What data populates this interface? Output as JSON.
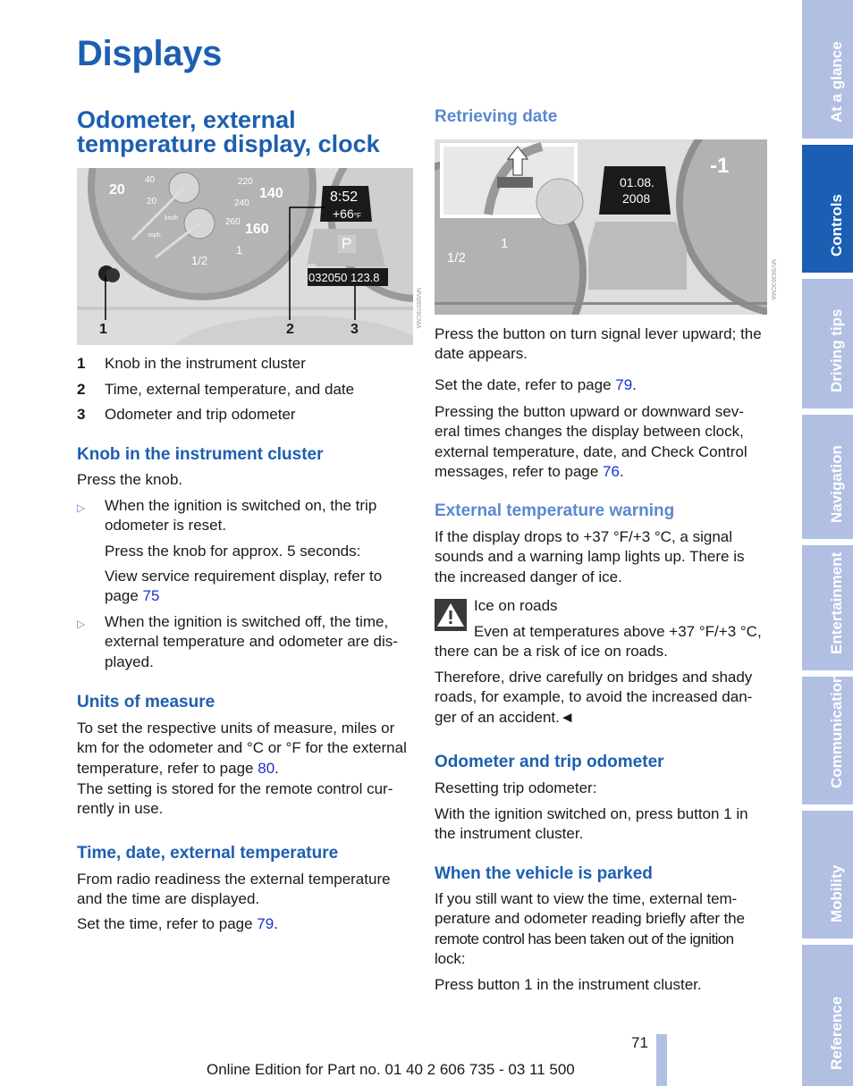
{
  "page_title": "Displays",
  "section_title": "Odometer, external temperature display, clock",
  "figure1": {
    "code": "MV06078CMA",
    "clock": "8:52",
    "temperature": "+66",
    "temp_unit": "°F",
    "gear": "P",
    "odo_unit": "mls",
    "odometer": "032050 123.8",
    "callouts": [
      "1",
      "2",
      "3"
    ],
    "gauge_labels": [
      "20",
      "40",
      "20",
      "km/h",
      "mph",
      "220",
      "240",
      "260",
      "140",
      "160",
      "1/2",
      "1"
    ]
  },
  "legend": [
    {
      "num": "1",
      "text": "Knob in the instrument cluster"
    },
    {
      "num": "2",
      "text": "Time, external temperature, and date"
    },
    {
      "num": "3",
      "text": "Odometer and trip odometer"
    }
  ],
  "knob": {
    "heading": "Knob in the instrument cluster",
    "intro": "Press the knob.",
    "bullet1": [
      "When the ignition is switched on, the trip",
      "odometer is reset."
    ],
    "sub1": "Press the knob for approx. 5 seconds:",
    "sub2_pre": [
      "View service requirement display, refer to",
      "page "
    ],
    "sub2_link": "75",
    "bullet2": [
      "When the ignition is switched off, the time,",
      "external temperature and odometer are dis-",
      "played."
    ]
  },
  "units": {
    "heading": "Units of measure",
    "para1": [
      "To set the respective units of measure, miles or",
      "km for the odometer and °C or °F for the external",
      "temperature, refer to page "
    ],
    "para1_link": "80",
    "para2": [
      "The setting is stored for the remote control cur-",
      "rently in use."
    ]
  },
  "timedate": {
    "heading": "Time, date, external temperature",
    "para1": [
      "From radio readiness the external temperature",
      "and the time are displayed."
    ],
    "para2_pre": "Set the time, refer to page ",
    "para2_link": "79"
  },
  "retrieving": {
    "heading": "Retrieving date",
    "figure_code": "MV06363CMA",
    "date_line1": "01.08.",
    "date_line2": "2008",
    "gauge_labels": [
      "-1",
      "1/2",
      "1"
    ],
    "para1": [
      "Press the button on turn signal lever upward; the",
      "date appears."
    ],
    "para2_pre": "Set the date, refer to page ",
    "para2_link": "79",
    "para3": [
      "Pressing the button upward or downward sev-",
      "eral times changes the display between clock,",
      "external temperature, date, and Check Control",
      "messages, refer to page "
    ],
    "para3_link": "76"
  },
  "temp_warning": {
    "heading": "External temperature warning",
    "para": [
      "If the display drops to +37 °F/+3 °C, a signal",
      "sounds and a warning lamp lights up. There is",
      "the increased danger of ice."
    ],
    "warning_icon": "warning-triangle-icon",
    "warning_title": "Ice on roads",
    "warning_line1": "Even at temperatures above +37 °F/+3 °C,",
    "warning_line2": "there can be a risk of ice on roads.",
    "para2": [
      "Therefore, drive carefully on bridges and shady",
      "roads, for example, to avoid the increased dan-",
      "ger of an accident.◄"
    ]
  },
  "odometer": {
    "heading": "Odometer and trip odometer",
    "para1": "Resetting trip odometer:",
    "para2": [
      "With the ignition switched on, press button 1 in",
      "the instrument cluster."
    ]
  },
  "parked": {
    "heading": "When the vehicle is parked",
    "para1": [
      "If you still want to view the time, external tem-",
      "perature and odometer reading briefly after the",
      "remote control has been taken out of the ignition",
      "lock:"
    ],
    "para2": "Press button 1 in the instrument cluster."
  },
  "footer": {
    "page_number": "71",
    "edition": "Online Edition for Part no. 01 40 2 606 735 - 03 11 500"
  },
  "sidebar": {
    "active": "Controls",
    "tabs": [
      "At a glance",
      "Controls",
      "Driving tips",
      "Navigation",
      "Entertainment",
      "Communication",
      "Mobility",
      "Reference"
    ]
  },
  "colors": {
    "heading": "#1d5fb0",
    "subheading_light": "#5a89cf",
    "link": "#1a2fd6",
    "tab": "#b1bfe3",
    "tab_active": "#1a5fb4"
  }
}
